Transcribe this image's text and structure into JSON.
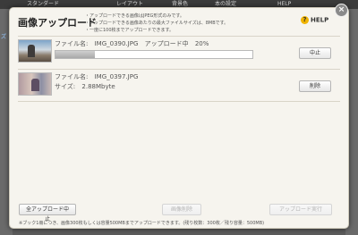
{
  "background": {
    "tabs": [
      {
        "label": "スタンダード"
      },
      {
        "label": "レイアウト"
      },
      {
        "label": "背景色"
      },
      {
        "label": "本の設定"
      },
      {
        "label": "HELP"
      }
    ],
    "left_text": "ズ"
  },
  "dialog": {
    "title": "画像アップロード",
    "notes": [
      "・アップロードできる画像はJPEG形式のみです。",
      "・アップロードできる画像あたりの最大ファイルサイズは、8MBです。",
      "・一度に100枚までアップロードできます。"
    ],
    "help_label": "HELP",
    "close_label": "×",
    "items": [
      {
        "file_label": "ファイル名:",
        "file_name": "IMG_0390.JPG",
        "status": "アップロード中",
        "progress_text": "20%",
        "progress": 0.2,
        "action_label": "中止"
      },
      {
        "file_label": "ファイル名:",
        "file_name": "IMG_0397.JPG",
        "size_label": "サイズ:",
        "size_value": "2.88Mbyte",
        "action_label": "削除"
      }
    ],
    "footer": {
      "cancel_all_label": "全アップロード中止",
      "delete_image_label": "画像削除",
      "run_upload_label": "アップロード実行",
      "note": "※ブック1冊につき、画像300枚もしくは容量500MBまでアップロードできます。(残り枚数：300枚／残り容量：500MB)"
    }
  }
}
